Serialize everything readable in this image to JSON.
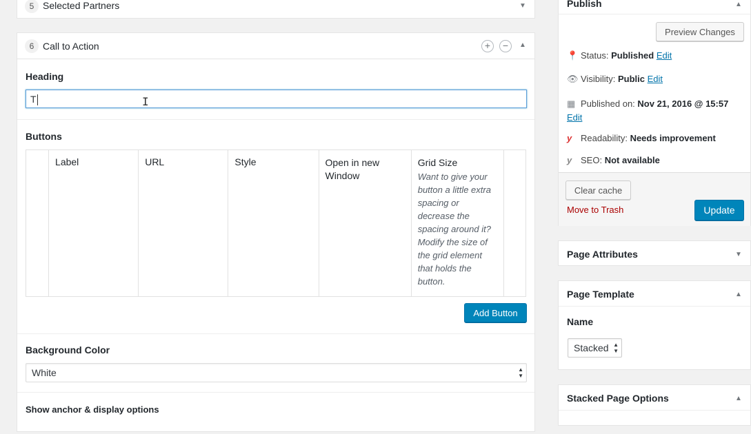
{
  "rows": {
    "selected_partners": {
      "num": "5",
      "title": "Selected Partners"
    },
    "call_to_action": {
      "num": "6",
      "title": "Call to Action"
    }
  },
  "cta": {
    "heading_label": "Heading",
    "heading_value": "T",
    "buttons_label": "Buttons",
    "columns": {
      "label": "Label",
      "url": "URL",
      "style": "Style",
      "new_window": "Open in new Window",
      "grid_size": "Grid Size",
      "grid_size_hint": "Want to give your button a little extra spacing or decrease the spacing around it? Modify the size of the grid element that holds the button."
    },
    "add_button": "Add Button",
    "bg_color_label": "Background Color",
    "bg_color_value": "White",
    "anchor_label": "Show anchor & display options"
  },
  "publish": {
    "title": "Publish",
    "preview_button": "Preview Changes",
    "status_label": "Status:",
    "status_value": "Published",
    "visibility_label": "Visibility:",
    "visibility_value": "Public",
    "published_on_label": "Published on:",
    "published_on_value": "Nov 21, 2016 @ 15:57",
    "edit": "Edit",
    "readability_label": "Readability:",
    "readability_value": "Needs improvement",
    "seo_label": "SEO:",
    "seo_value": "Not available",
    "clear_cache": "Clear cache",
    "trash": "Move to Trash",
    "update": "Update"
  },
  "page_attributes": {
    "title": "Page Attributes"
  },
  "page_template": {
    "title": "Page Template",
    "name_label": "Name",
    "template_value": "Stacked"
  },
  "stacked_options": {
    "title": "Stacked Page Options"
  },
  "colors": {
    "primary": "#0085ba",
    "link": "#0073aa",
    "danger": "#a00000"
  }
}
